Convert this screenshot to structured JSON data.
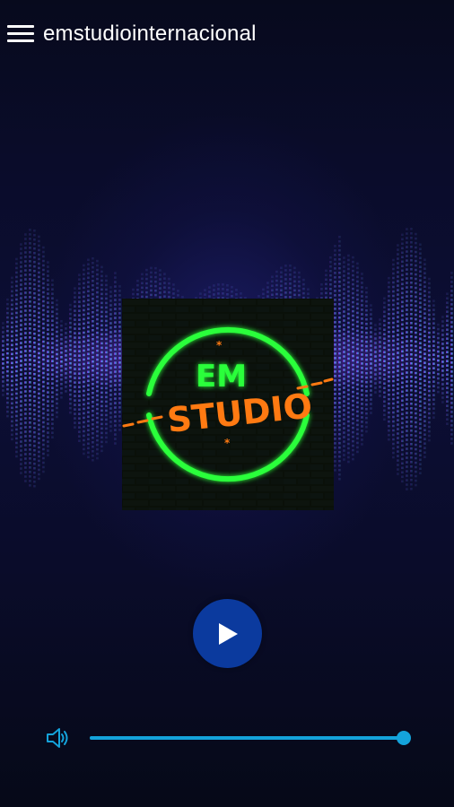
{
  "header": {
    "menu_icon": "hamburger-menu-icon",
    "title": "emstudiointernacional"
  },
  "artwork": {
    "logo_line1": "EM",
    "logo_line2": "STUDIO",
    "colors": {
      "neon_green": "#2bff3a",
      "orange": "#ff7a12",
      "brick": "#0f1a12"
    }
  },
  "player": {
    "play_icon": "play-icon",
    "state": "paused"
  },
  "volume": {
    "icon": "speaker-volume-icon",
    "level": 1.0,
    "colors": {
      "fill": "#14a3db",
      "track": "#0a4f7a"
    }
  },
  "theme": {
    "background": "#070b1c",
    "visualizer_colors": [
      "#6b3bd6",
      "#a24ee8",
      "#3a7ff0",
      "#7cc6ff"
    ]
  }
}
